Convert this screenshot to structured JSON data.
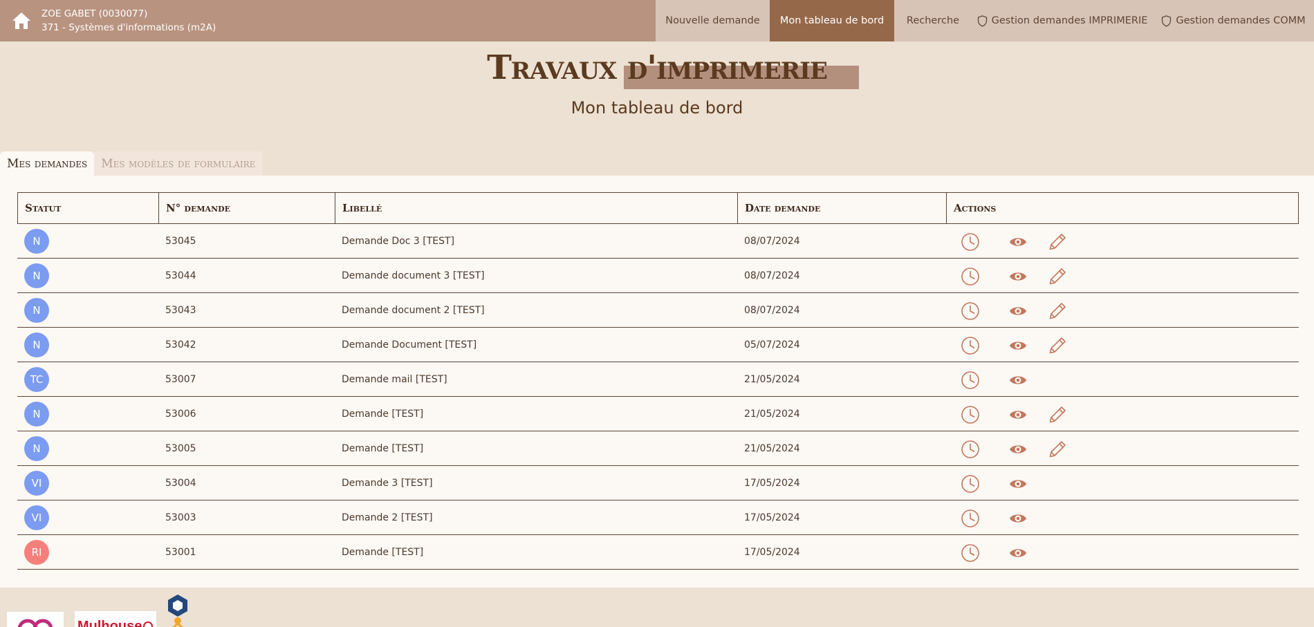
{
  "header": {
    "user_name": "ZOE GABET (0030077)",
    "user_unit": "371 - Systèmes d'informations (m2A)",
    "nav": [
      {
        "label": "Nouvelle demande",
        "active": false
      },
      {
        "label": "Mon tableau de bord",
        "active": true
      },
      {
        "label": "Recherche",
        "active": false
      },
      {
        "label": "Gestion demandes IMPRIMERIE",
        "active": false,
        "icon": "shield-icon"
      },
      {
        "label": "Gestion demandes COMM",
        "active": false,
        "icon": "shield-icon"
      }
    ]
  },
  "page": {
    "title": "Travaux d'imprimerie",
    "subtitle": "Mon tableau de bord"
  },
  "tabs": [
    {
      "label": "Mes demandes",
      "active": true
    },
    {
      "label": "Mes modèles de formulaire",
      "active": false
    }
  ],
  "table": {
    "columns": [
      "Statut",
      "N° demande",
      "Libellé",
      "Date demande",
      "Actions"
    ],
    "rows": [
      {
        "status": "N",
        "status_color": "#7b9cf0",
        "number": "53045",
        "label": "Demande Doc 3 [TEST]",
        "date": "08/07/2024",
        "editable": true
      },
      {
        "status": "N",
        "status_color": "#7b9cf0",
        "number": "53044",
        "label": "Demande document 3 [TEST]",
        "date": "08/07/2024",
        "editable": true
      },
      {
        "status": "N",
        "status_color": "#7b9cf0",
        "number": "53043",
        "label": "Demande document 2 [TEST]",
        "date": "08/07/2024",
        "editable": true
      },
      {
        "status": "N",
        "status_color": "#7b9cf0",
        "number": "53042",
        "label": "Demande Document [TEST]",
        "date": "05/07/2024",
        "editable": true
      },
      {
        "status": "TC",
        "status_color": "#7b9cf0",
        "number": "53007",
        "label": "Demande mail [TEST]",
        "date": "21/05/2024",
        "editable": false
      },
      {
        "status": "N",
        "status_color": "#7b9cf0",
        "number": "53006",
        "label": "Demande [TEST]",
        "date": "21/05/2024",
        "editable": true
      },
      {
        "status": "N",
        "status_color": "#7b9cf0",
        "number": "53005",
        "label": "Demande [TEST]",
        "date": "21/05/2024",
        "editable": true
      },
      {
        "status": "VI",
        "status_color": "#7b9cf0",
        "number": "53004",
        "label": "Demande 3 [TEST]",
        "date": "17/05/2024",
        "editable": false
      },
      {
        "status": "VI",
        "status_color": "#7b9cf0",
        "number": "53003",
        "label": "Demande 2 [TEST]",
        "date": "17/05/2024",
        "editable": false
      },
      {
        "status": "RI",
        "status_color": "#f57f7a",
        "number": "53001",
        "label": "Demande [TEST]",
        "date": "17/05/2024",
        "editable": false
      }
    ]
  },
  "footer": {
    "logo2_text": "Mulhouse"
  },
  "colors": {
    "topbar": "#b89380",
    "nav_active": "#95684a",
    "accent_icon": "#c2775c"
  }
}
